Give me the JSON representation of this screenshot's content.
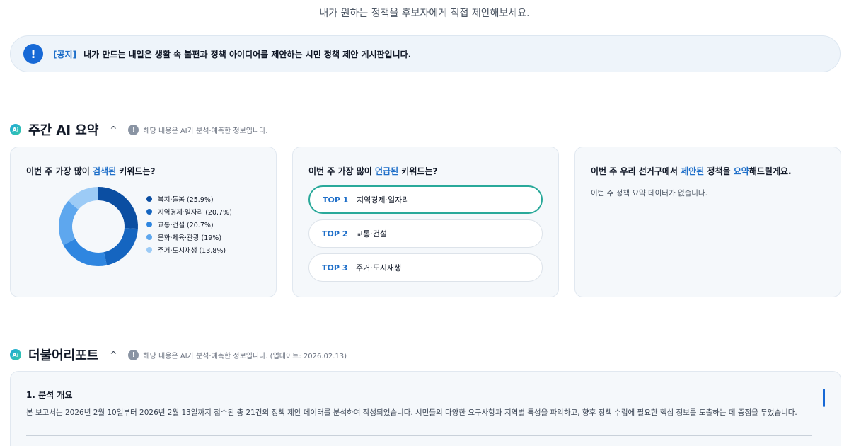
{
  "subtitle": "내가 원하는 정책을 후보자에게 직접 제안해보세요.",
  "notice": {
    "icon": "exclamation-icon",
    "tag": "[공지]",
    "text": "내가 만드는 내일은 생활 속 불편과 정책 아이디어를 제안하는 시민 정책 제안 게시판입니다."
  },
  "weekly": {
    "badge": "Ai",
    "title": "주간 AI 요약",
    "toggle": "^",
    "info_icon": "!",
    "info": "해당 내용은 AI가 분석·예측한 정보입니다."
  },
  "cards": {
    "search": {
      "title_pre": "이번 주 가장 많이 ",
      "title_hl": "검색된",
      "title_post": " 키워드는?",
      "legend": [
        {
          "label": "복지·돌봄 (25.9%)",
          "color": "#0b4ea2"
        },
        {
          "label": "지역경제·일자리 (20.7%)",
          "color": "#1565c0"
        },
        {
          "label": "교통·건설 (20.7%)",
          "color": "#2f86e0"
        },
        {
          "label": "문화·체육·관광 (19%)",
          "color": "#5ea7ee"
        },
        {
          "label": "주거·도시재생 (13.8%)",
          "color": "#9ccbf6"
        }
      ]
    },
    "mentioned": {
      "title_pre": "이번 주 가장 많이 ",
      "title_hl": "언급된",
      "title_post": " 키워드는?",
      "items": [
        {
          "rank": "TOP 1",
          "label": "지역경제·일자리"
        },
        {
          "rank": "TOP 2",
          "label": "교통·건설"
        },
        {
          "rank": "TOP 3",
          "label": "주거·도시재생"
        }
      ]
    },
    "policy": {
      "title_pre": "이번 주 우리 선거구에서 ",
      "title_hl1": "제안된",
      "title_mid": " 정책을 ",
      "title_hl2": "요약",
      "title_post": "해드릴게요.",
      "empty": "이번 주 정책 요약 데이터가 없습니다."
    }
  },
  "chart_data": {
    "type": "pie",
    "categories": [
      "복지·돌봄",
      "지역경제·일자리",
      "교통·건설",
      "문화·체육·관광",
      "주거·도시재생"
    ],
    "values": [
      25.9,
      20.7,
      20.7,
      19,
      13.8
    ],
    "colors": [
      "#0b4ea2",
      "#1565c0",
      "#2f86e0",
      "#5ea7ee",
      "#9ccbf6"
    ],
    "donut": true,
    "legend_position": "right"
  },
  "report": {
    "badge": "Ai",
    "title": "더불어리포트",
    "toggle": "^",
    "info_icon": "!",
    "info": "해당 내용은 AI가 분석·예측한 정보입니다. (업데이트: 2026.02.13)",
    "heading": "1. 분석 개요",
    "body": "본 보고서는 2026년 2월 10일부터 2026년 2월 13일까지 접수된 총 21건의 정책 제안 데이터를 분석하여 작성되었습니다. 시민들의 다양한 요구사항과 지역별 특성을 파악하고, 향후 정책 수립에 필요한 핵심 정보를 도출하는 데 중점을 두었습니다."
  }
}
